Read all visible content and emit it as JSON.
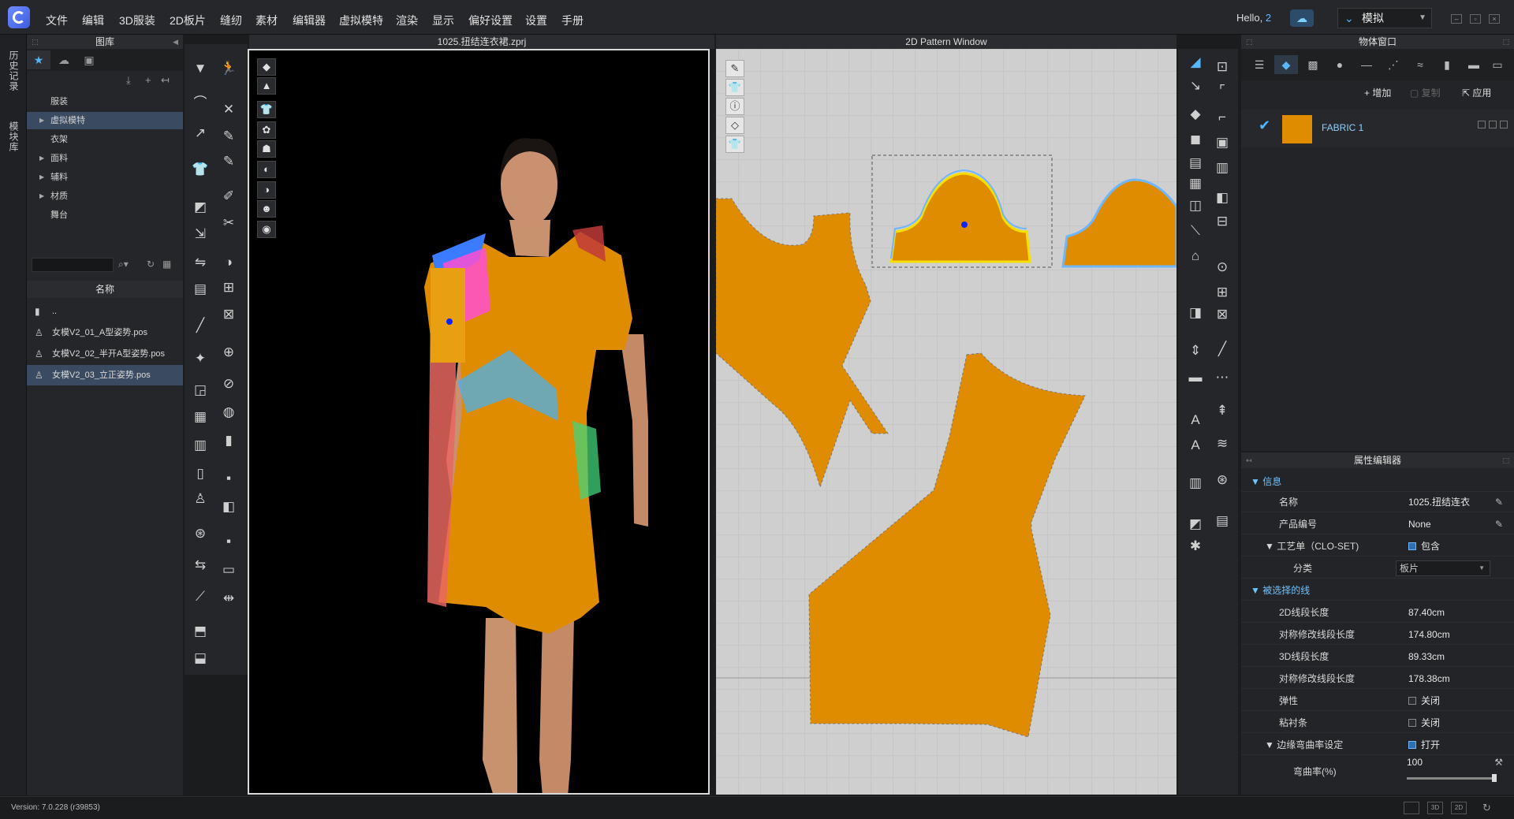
{
  "menu": [
    "文件",
    "编辑",
    "3D服装",
    "2D板片",
    "缝纫",
    "素材",
    "编辑器",
    "虚拟模特",
    "渲染",
    "显示",
    "偏好设置",
    "设置",
    "手册"
  ],
  "user": {
    "greeting": "Hello,",
    "count": "2"
  },
  "mode": "模拟",
  "side_tabs": [
    "历史记录",
    "模块库"
  ],
  "library": {
    "title": "图库",
    "tree": [
      "服装",
      "虚拟模特",
      "衣架",
      "面料",
      "辅料",
      "材质",
      "舞台"
    ],
    "selected_tree": "虚拟模特",
    "name_header": "名称",
    "files": [
      "..",
      "女模V2_01_A型姿势.pos",
      "女模V2_02_半开A型姿势.pos",
      "女模V2_03_立正姿势.pos"
    ],
    "selected_file": "女模V2_03_立正姿势.pos"
  },
  "view3d": {
    "title": "1025.扭结连衣裙.zprj"
  },
  "view2d": {
    "title": "2D Pattern Window"
  },
  "object_window": {
    "title": "物体窗口",
    "add_label": "增加",
    "copy_label": "复制",
    "apply_label": "应用",
    "fabric_name": "FABRIC 1",
    "fabric_color": "#e08c00"
  },
  "property_editor": {
    "title": "属性编辑器",
    "info_section": "信息",
    "name_key": "名称",
    "name_value": "1025.扭结连衣",
    "product_key": "产品编号",
    "product_value": "None",
    "clo_set_key": "工艺单（CLO-SET)",
    "clo_set_value": "包含",
    "category_key": "分类",
    "category_value": "板片",
    "selected_line_section": "被选择的线",
    "len2d_key": "2D线段长度",
    "len2d_value": "87.40cm",
    "sym2d_key": "对称修改线段长度",
    "sym2d_value": "174.80cm",
    "len3d_key": "3D线段长度",
    "len3d_value": "89.33cm",
    "sym3d_key": "对称修改线段长度",
    "sym3d_value": "178.38cm",
    "elastic_key": "弹性",
    "elastic_value": "关闭",
    "tape_key": "粘衬条",
    "tape_value": "关闭",
    "curve_key": "边缘弯曲率设定",
    "curve_value": "打开",
    "curvature_key": "弯曲率(%)",
    "curvature_value": "100"
  },
  "status": {
    "version": "Version: 7.0.228 (r39853)"
  },
  "colors": {
    "accent": "#4fb6ff",
    "fabric": "#e08c00",
    "selection": "#3a4b61"
  }
}
